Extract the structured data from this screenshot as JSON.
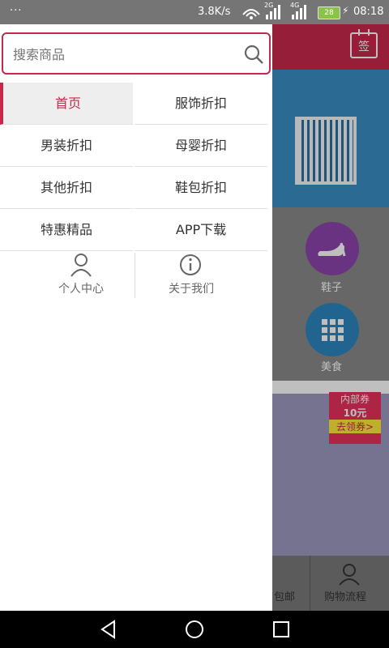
{
  "status_bar": {
    "left_dots": "···",
    "speed": "3.8K/s",
    "signal1_label": "2G",
    "signal2_label": "4G",
    "battery": "28",
    "time": "08:18"
  },
  "background": {
    "sign_label": "签",
    "categories": [
      {
        "label": "鞋子",
        "icon": "high-heel-shoe-icon",
        "color": "#8e44ad"
      },
      {
        "label": "美食",
        "icon": "grid-icon",
        "color": "#2e86c1"
      }
    ],
    "promo": {
      "line1": "内部券",
      "line2": "10元",
      "button": "去领券>"
    },
    "footer": {
      "item1": "包邮",
      "item2": "购物流程"
    }
  },
  "drawer": {
    "search_placeholder": "搜索商品",
    "menu": [
      {
        "label": "首页",
        "active": true
      },
      {
        "label": "服饰折扣"
      },
      {
        "label": "男装折扣"
      },
      {
        "label": "母婴折扣"
      },
      {
        "label": "其他折扣"
      },
      {
        "label": "鞋包折扣"
      },
      {
        "label": "特惠精品"
      },
      {
        "label": "APP下载"
      }
    ],
    "bottom": [
      {
        "label": "个人中心",
        "icon": "person-icon"
      },
      {
        "label": "关于我们",
        "icon": "info-icon"
      }
    ]
  },
  "colors": {
    "accent": "#c8294b"
  }
}
